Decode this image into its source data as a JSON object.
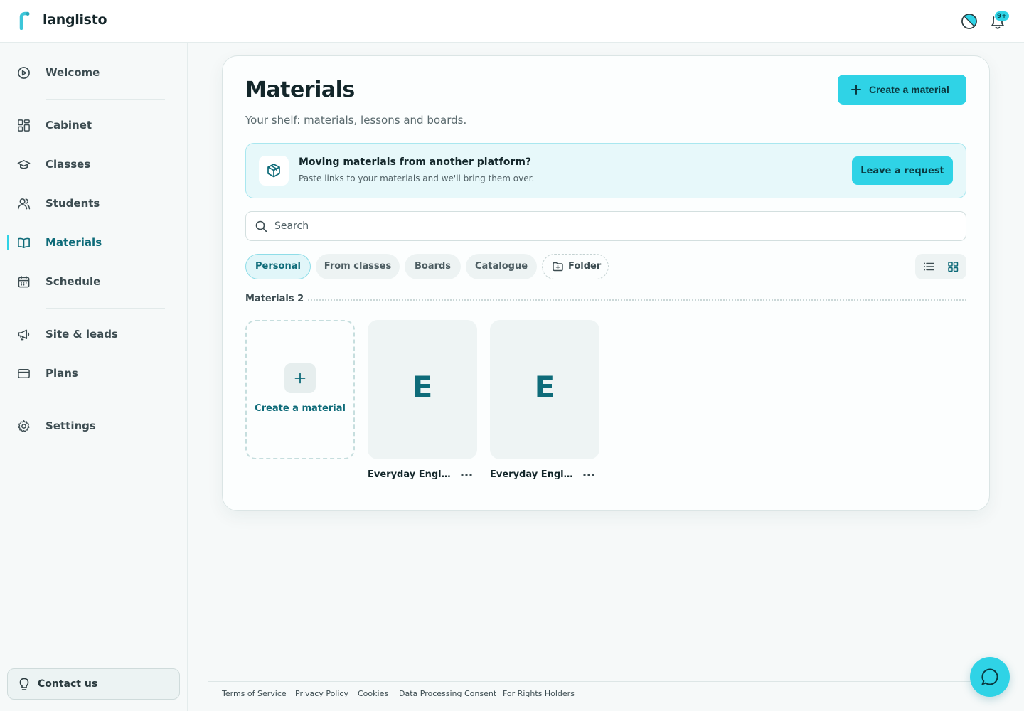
{
  "app": {
    "name": "langlisto"
  },
  "header": {
    "notifications_badge": "9+"
  },
  "sidebar": {
    "items": [
      {
        "label": "Welcome",
        "icon": "play-circle-icon"
      },
      {
        "label": "Cabinet",
        "icon": "dashboard-icon"
      },
      {
        "label": "Classes",
        "icon": "graduation-cap-icon"
      },
      {
        "label": "Students",
        "icon": "users-icon"
      },
      {
        "label": "Materials",
        "icon": "book-open-icon",
        "active": true
      },
      {
        "label": "Schedule",
        "icon": "calendar-icon"
      },
      {
        "label": "Site & leads",
        "icon": "megaphone-icon"
      },
      {
        "label": "Plans",
        "icon": "credit-card-icon"
      },
      {
        "label": "Settings",
        "icon": "gear-icon"
      }
    ],
    "contact_label": "Contact us"
  },
  "main": {
    "title": "Materials",
    "subtitle": "Your shelf: materials, lessons and boards.",
    "create_button_label": "Create a material",
    "banner": {
      "title": "Moving materials from another platform?",
      "description": "Paste links to your materials and we'll bring them over.",
      "button_label": "Leave a request"
    },
    "search": {
      "placeholder": "Search",
      "value": ""
    },
    "tabs": [
      {
        "label": "Personal",
        "active": true
      },
      {
        "label": "From classes"
      },
      {
        "label": "Boards"
      },
      {
        "label": "Catalogue"
      },
      {
        "label": "Folder"
      }
    ],
    "view_mode": "grid",
    "section_label": "Materials 2",
    "new_tile_label": "Create a material",
    "materials": [
      {
        "letter": "E",
        "name": "Everyday Engli..."
      },
      {
        "letter": "E",
        "name": "Everyday Engli..."
      }
    ]
  },
  "footer": {
    "links": [
      "Terms of Service",
      "Privacy Policy",
      "Cookies",
      "Data Processing Consent",
      "For Rights Holders"
    ]
  },
  "colors": {
    "accent": "#2fd3e6",
    "accent_dark": "#0e6b79",
    "text": "#16272b"
  }
}
